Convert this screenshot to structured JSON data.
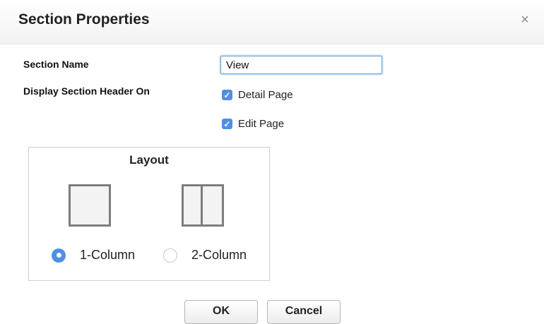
{
  "dialog": {
    "title": "Section Properties",
    "close_glyph": "×",
    "close_icon": "close-icon"
  },
  "form": {
    "section_name_label": "Section Name",
    "section_name_value": "View",
    "display_header_label": "Display Section Header On",
    "options": [
      {
        "label": "Detail Page",
        "checked": true
      },
      {
        "label": "Edit Page",
        "checked": true
      }
    ]
  },
  "layout": {
    "title": "Layout",
    "choices": [
      {
        "label": "1-Column",
        "selected": true,
        "icon": "one-column-icon"
      },
      {
        "label": "2-Column",
        "selected": false,
        "icon": "two-column-icon"
      }
    ]
  },
  "buttons": {
    "ok": "OK",
    "cancel": "Cancel"
  },
  "colors": {
    "accent": "#4e90e2",
    "input_focus": "#6fa1d6"
  }
}
